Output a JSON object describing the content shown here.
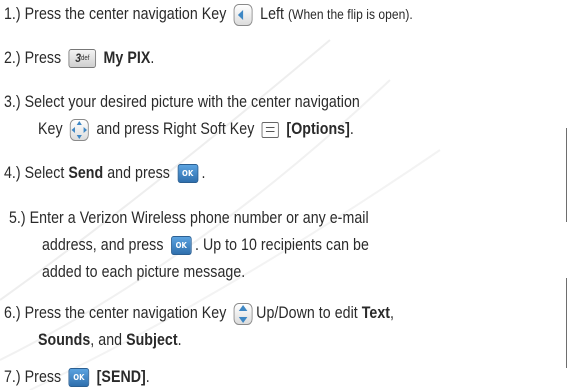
{
  "steps": {
    "s1": {
      "num": "1.) Press the center navigation Key",
      "text": "Left",
      "note": "(When the flip is open)."
    },
    "s2": {
      "num": "2.) Press",
      "key_label": "3",
      "key_sup": "def",
      "bold": "My PIX",
      "end": "."
    },
    "s3": {
      "line1": "3.) Select your desired picture with the center navigation",
      "line2a": "Key",
      "line2b": "and press Right Soft Key",
      "bold": "[Options]",
      "end": "."
    },
    "s4": {
      "a": "4.) Select",
      "bold": "Send",
      "b": "and press",
      "end": "."
    },
    "s5": {
      "line1": "5.) Enter a Verizon Wireless phone number or any e-mail",
      "line2a": "address, and press",
      "line2b": ". Up to 10 recipients can be",
      "line3": "added to each picture message."
    },
    "s6": {
      "a": "6.) Press the center navigation Key",
      "b": "Up/Down to edit",
      "bold1": "Text",
      "comma": ",",
      "bold2": "Sounds",
      "c": ", and",
      "bold3": "Subject",
      "end": "."
    },
    "s7": {
      "a": "7.) Press",
      "bold": "[SEND]",
      "end": "."
    }
  },
  "keys": {
    "ok_label": "OK"
  }
}
